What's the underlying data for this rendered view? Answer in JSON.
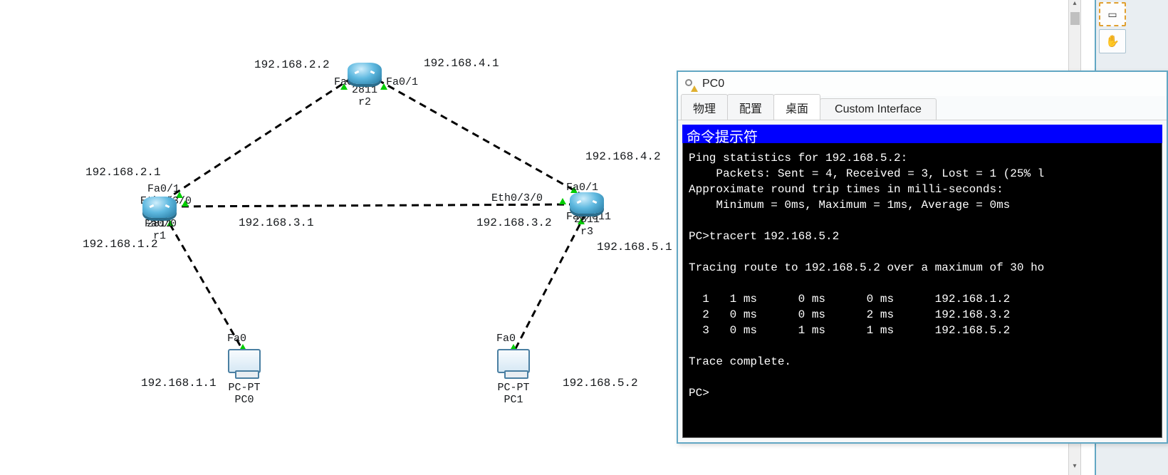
{
  "tools": {
    "select_marquee": "selection-marquee",
    "hand_grab": "hand-tool"
  },
  "topology": {
    "devices": {
      "r2": {
        "model": "2811",
        "name": "r2",
        "interfaces": {
          "left": "Fa0/0",
          "right": "Fa0/1"
        }
      },
      "r1": {
        "model": "2811",
        "name": "r1",
        "interfaces": {
          "up": "Fa0/1",
          "right": "Eth0/3/0",
          "down": "Fa0/0"
        }
      },
      "r3": {
        "model": "2811",
        "name": "r3",
        "interfaces": {
          "up": "Fa0/1",
          "left": "Eth0/3/0",
          "down": "Fa0/811"
        }
      },
      "pc0": {
        "model": "PC-PT",
        "name": "PC0",
        "iface": "Fa0"
      },
      "pc1": {
        "model": "PC-PT",
        "name": "PC1",
        "iface": "Fa0"
      }
    },
    "ip_labels": {
      "r2l": "192.168.2.2",
      "r2r": "192.168.4.1",
      "r1u": "192.168.2.1",
      "r1d": "192.168.1.2",
      "r3u": "192.168.4.2",
      "r3d": "192.168.5.1",
      "l13a": "192.168.3.1",
      "l13b": "192.168.3.2",
      "pc0": "192.168.1.1",
      "pc1": "192.168.5.2"
    }
  },
  "pcwin": {
    "title": "PC0",
    "tabs": {
      "physical": "物理",
      "config": "配置",
      "desktop": "桌面",
      "custom": "Custom Interface"
    },
    "terminal_header": "命令提示符",
    "terminal_body": "Ping statistics for 192.168.5.2:\n    Packets: Sent = 4, Received = 3, Lost = 1 (25% l\nApproximate round trip times in milli-seconds:\n    Minimum = 0ms, Maximum = 1ms, Average = 0ms\n\nPC>tracert 192.168.5.2\n\nTracing route to 192.168.5.2 over a maximum of 30 ho\n\n  1   1 ms      0 ms      0 ms      192.168.1.2\n  2   0 ms      0 ms      2 ms      192.168.3.2\n  3   0 ms      1 ms      1 ms      192.168.5.2\n\nTrace complete.\n\nPC>"
  }
}
